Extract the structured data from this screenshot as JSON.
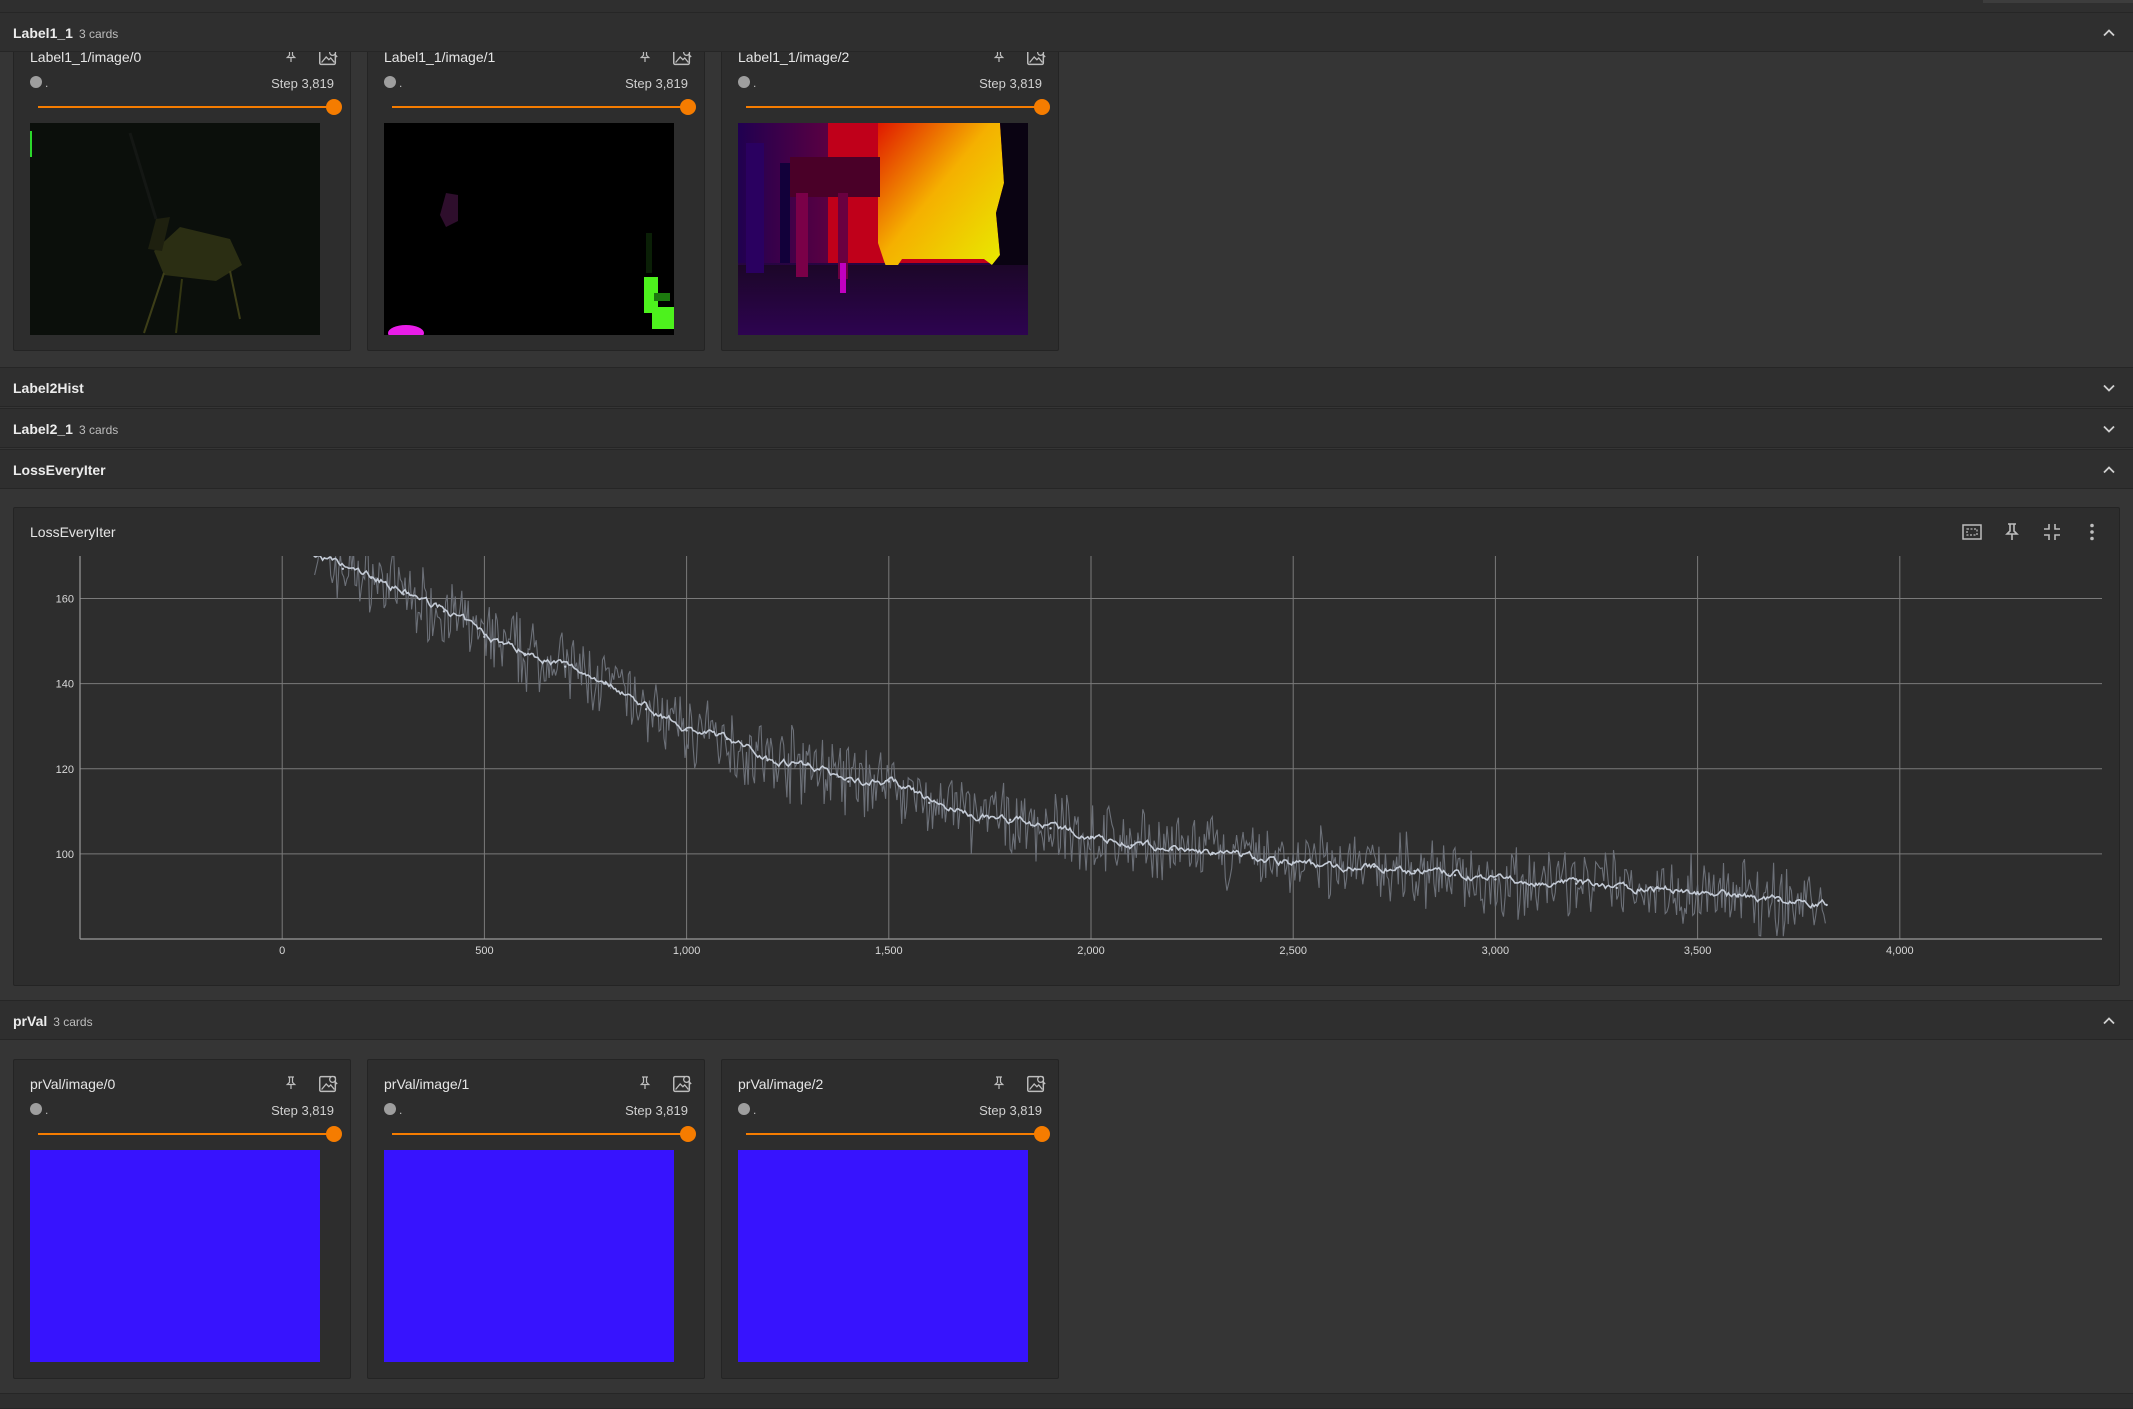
{
  "groups": {
    "label1_1": {
      "title": "Label1_1",
      "count": "3 cards",
      "expanded": true
    },
    "label2hist": {
      "title": "Label2Hist",
      "expanded": false
    },
    "label2_1": {
      "title": "Label2_1",
      "count": "3 cards",
      "expanded": false
    },
    "loss": {
      "title": "LossEveryIter",
      "expanded": true
    },
    "prval": {
      "title": "prVal",
      "count": "3 cards",
      "expanded": true
    }
  },
  "label1_1_cards": [
    {
      "title": "Label1_1/image/0",
      "run": ".",
      "step": "Step 3,819"
    },
    {
      "title": "Label1_1/image/1",
      "run": ".",
      "step": "Step 3,819"
    },
    {
      "title": "Label1_1/image/2",
      "run": ".",
      "step": "Step 3,819"
    }
  ],
  "prval_cards": [
    {
      "title": "prVal/image/0",
      "run": ".",
      "step": "Step 3,819"
    },
    {
      "title": "prVal/image/1",
      "run": ".",
      "step": "Step 3,819"
    },
    {
      "title": "prVal/image/2",
      "run": ".",
      "step": "Step 3,819"
    }
  ],
  "loss_card": {
    "title": "LossEveryIter"
  },
  "colors": {
    "accent": "#f57c00",
    "prval_image": "#3713fe",
    "line_smoothed": "#c4cbd6",
    "line_raw": "#6c7078"
  },
  "chart_data": {
    "type": "line",
    "title": "LossEveryIter",
    "xlabel": "",
    "ylabel": "",
    "xlim": [
      -500,
      4500
    ],
    "ylim": [
      80,
      170
    ],
    "xticks": [
      0,
      500,
      1000,
      1500,
      2000,
      2500,
      3000,
      3500,
      4000
    ],
    "xtick_labels": [
      "0",
      "500",
      "1,000",
      "1,500",
      "2,000",
      "2,500",
      "3,000",
      "3,500",
      "4,000"
    ],
    "yticks": [
      100,
      120,
      140,
      160
    ],
    "ytick_labels": [
      "100",
      "120",
      "140",
      "160"
    ],
    "grid": true,
    "series": [
      {
        "x": [
          80,
          150,
          220,
          300,
          400,
          500,
          600,
          700,
          800,
          900,
          1000,
          1100,
          1200,
          1300,
          1400,
          1500,
          1600,
          1700,
          1800,
          1900,
          2000,
          2100,
          2200,
          2300,
          2400,
          2500,
          2600,
          2700,
          2800,
          2900,
          3000,
          3100,
          3200,
          3300,
          3400,
          3500,
          3600,
          3700,
          3819
        ],
        "y": [
          170,
          167,
          165,
          161,
          157,
          151,
          147,
          144,
          140,
          134,
          129,
          127,
          122,
          121,
          117,
          117,
          112,
          109,
          108,
          106,
          104,
          102,
          101,
          100,
          99,
          98,
          97,
          97,
          96,
          95,
          94,
          93,
          93,
          92,
          92,
          91,
          90,
          89,
          88
        ]
      }
    ]
  }
}
